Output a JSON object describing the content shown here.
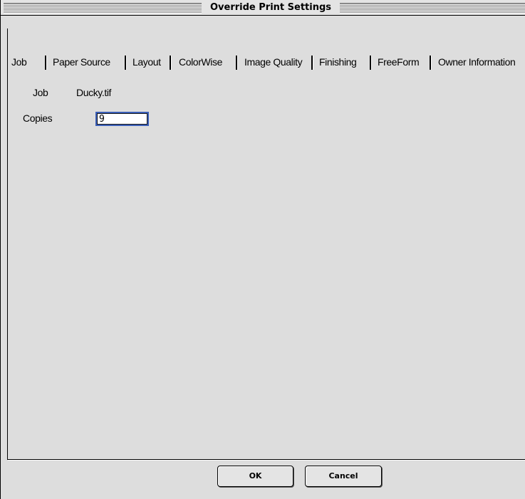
{
  "window": {
    "title": "Override Print Settings"
  },
  "tabs": [
    {
      "label": "Job",
      "selected": true
    },
    {
      "label": "Paper Source",
      "selected": false
    },
    {
      "label": "Layout",
      "selected": false
    },
    {
      "label": "ColorWise",
      "selected": false
    },
    {
      "label": "Image Quality",
      "selected": false
    },
    {
      "label": "Finishing",
      "selected": false
    },
    {
      "label": "FreeForm",
      "selected": false
    },
    {
      "label": "Owner Information",
      "selected": false
    }
  ],
  "job": {
    "label": "Job",
    "value": "Ducky.tif"
  },
  "copies": {
    "label": "Copies",
    "value": "9"
  },
  "buttons": {
    "ok_label": "OK",
    "cancel_label": "Cancel"
  },
  "colors": {
    "background": "#dddddd",
    "focus_ring": "#3a5fb8"
  }
}
